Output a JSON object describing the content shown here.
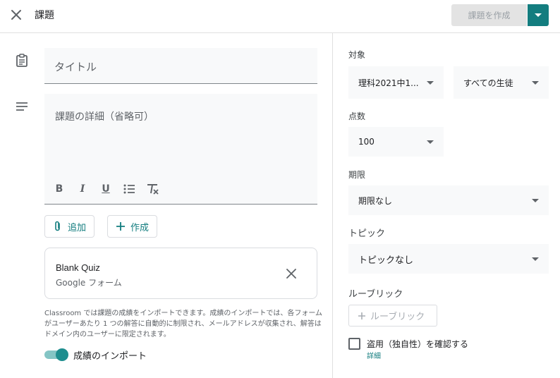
{
  "header": {
    "title": "課題",
    "create_label": "課題を作成"
  },
  "form": {
    "title_placeholder": "タイトル",
    "detail_placeholder": "課題の詳細（省略可）",
    "add_label": "追加",
    "create_label": "作成"
  },
  "attachment": {
    "name": "Blank Quiz",
    "type": "Google フォーム"
  },
  "note": "Classroom では課題の成績をインポートできます。成績のインポートでは、各フォームがユーザーあたり 1 つの解答に自動的に制限され、メールアドレスが収集され、解答はドメイン内のユーザーに限定されます。",
  "toggle": {
    "label": "成績のインポート",
    "on": true
  },
  "settings": {
    "target_label": "対象",
    "class_value": "理科2021中1...",
    "students_value": "すべての生徒",
    "points_label": "点数",
    "points_value": "100",
    "due_label": "期限",
    "due_value": "期限なし",
    "topic_label": "トピック",
    "topic_value": "トピックなし",
    "rubric_label": "ルーブリック",
    "rubric_button": "ルーブリック",
    "plagiarism_label": "盗用（独自性）を確認する",
    "plagiarism_link": "詳細"
  },
  "colors": {
    "accent": "#137d7f",
    "toggle_knob": "#1e8e8f",
    "toggle_track": "#84c5c5"
  }
}
